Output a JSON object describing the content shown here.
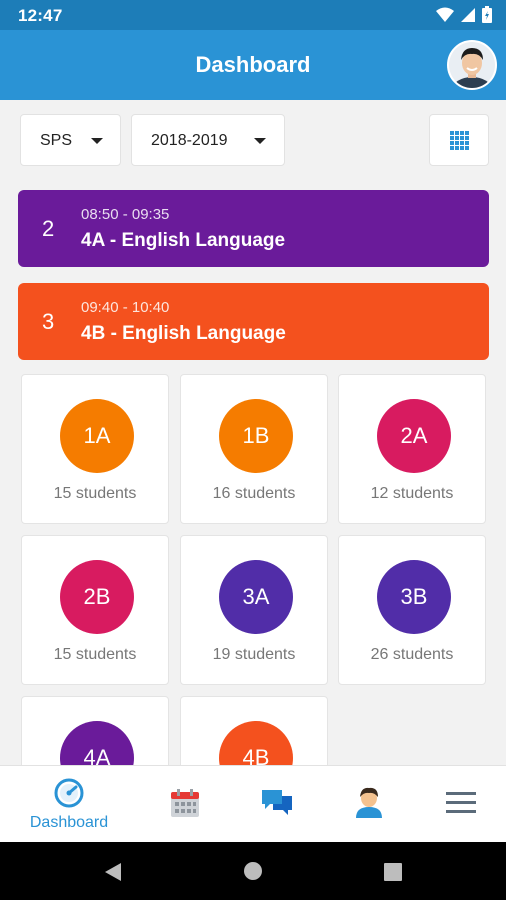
{
  "status_bar": {
    "time": "12:47"
  },
  "app_bar": {
    "title": "Dashboard",
    "avatar_icon": "user-avatar"
  },
  "filters": {
    "school": "SPS",
    "year": "2018-2019",
    "view_toggle_icon": "grid-icon"
  },
  "lessons": [
    {
      "period": "2",
      "time": "08:50 - 09:35",
      "subject": "4A - English Language",
      "color": "#6a1b9a"
    },
    {
      "period": "3",
      "time": "09:40 - 10:40",
      "subject": "4B - English Language",
      "color": "#f4511e"
    }
  ],
  "classes": [
    {
      "name": "1A",
      "students": "15 students",
      "color": "#f57c00"
    },
    {
      "name": "1B",
      "students": "16 students",
      "color": "#f57c00"
    },
    {
      "name": "2A",
      "students": "12 students",
      "color": "#d81b60"
    },
    {
      "name": "2B",
      "students": "15 students",
      "color": "#d81b60"
    },
    {
      "name": "3A",
      "students": "19 students",
      "color": "#512da8"
    },
    {
      "name": "3B",
      "students": "26 students",
      "color": "#512da8"
    },
    {
      "name": "4A",
      "students": "",
      "color": "#6a1b9a"
    },
    {
      "name": "4B",
      "students": "",
      "color": "#f4511e"
    }
  ],
  "bottom_nav": [
    {
      "label": "Dashboard",
      "icon": "dashboard-gauge-icon",
      "active": true
    },
    {
      "label": "",
      "icon": "calendar-icon"
    },
    {
      "label": "",
      "icon": "chat-icon"
    },
    {
      "label": "",
      "icon": "profile-icon"
    },
    {
      "label": "",
      "icon": "menu-icon"
    }
  ],
  "colors": {
    "primary": "#2a93d5",
    "status_bar": "#1d7db8"
  }
}
